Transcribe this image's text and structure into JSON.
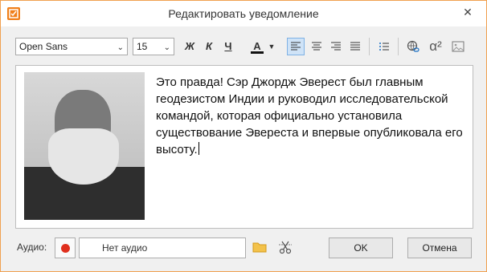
{
  "window": {
    "title": "Редактировать уведомление",
    "close_symbol": "✕",
    "accent_color": "#f07f1a"
  },
  "toolbar": {
    "font_value": "Open Sans",
    "size_value": "15",
    "bold_label": "Ж",
    "italic_label": "К",
    "underline_label": "Ч",
    "text_color_label": "A",
    "text_color": "#111111",
    "superscript_label": "α²"
  },
  "editor": {
    "text": "Это правда! Сэр Джордж Эверест был главным геодезистом Индии и руководил исследовательской командой, которая официально установила существование Эвереста и впервые опубликовала его высоту."
  },
  "audio": {
    "label": "Аудио:",
    "value": "Нет аудио",
    "record_color": "#e0301e"
  },
  "buttons": {
    "ok": "OK",
    "cancel": "Отмена"
  }
}
